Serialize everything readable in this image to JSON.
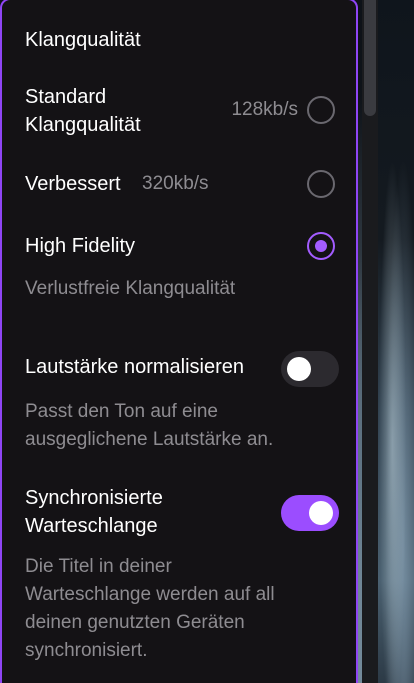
{
  "panel": {
    "title": "Klangqualität",
    "quality": {
      "standard": {
        "label_line1": "Standard",
        "label_line2": "Klangqualität",
        "bitrate": "128kb/s",
        "selected": false
      },
      "enhanced": {
        "label": "Verbessert",
        "bitrate": "320kb/s",
        "selected": false
      },
      "hifi": {
        "label": "High Fidelity",
        "description": "Verlustfreie Klangqualität",
        "selected": true
      }
    },
    "normalize": {
      "label": "Lautstärke normalisieren",
      "description_line1": "Passt den Ton auf eine",
      "description_line2": "ausgeglichene Lautstärke an.",
      "enabled": false
    },
    "sync_queue": {
      "label_line1": "Synchronisierte",
      "label_line2": "Warteschlange",
      "description_line1": "Die Titel in deiner",
      "description_line2": "Warteschlange werden auf all",
      "description_line3": "deinen genutzten Geräten",
      "description_line4": "synchronisiert.",
      "enabled": true
    }
  },
  "colors": {
    "accent": "#9b4dff",
    "panel_bg": "#141215",
    "muted_text": "#8e8c91"
  },
  "icons": {
    "radio": "radio-button",
    "toggle": "toggle-switch"
  }
}
